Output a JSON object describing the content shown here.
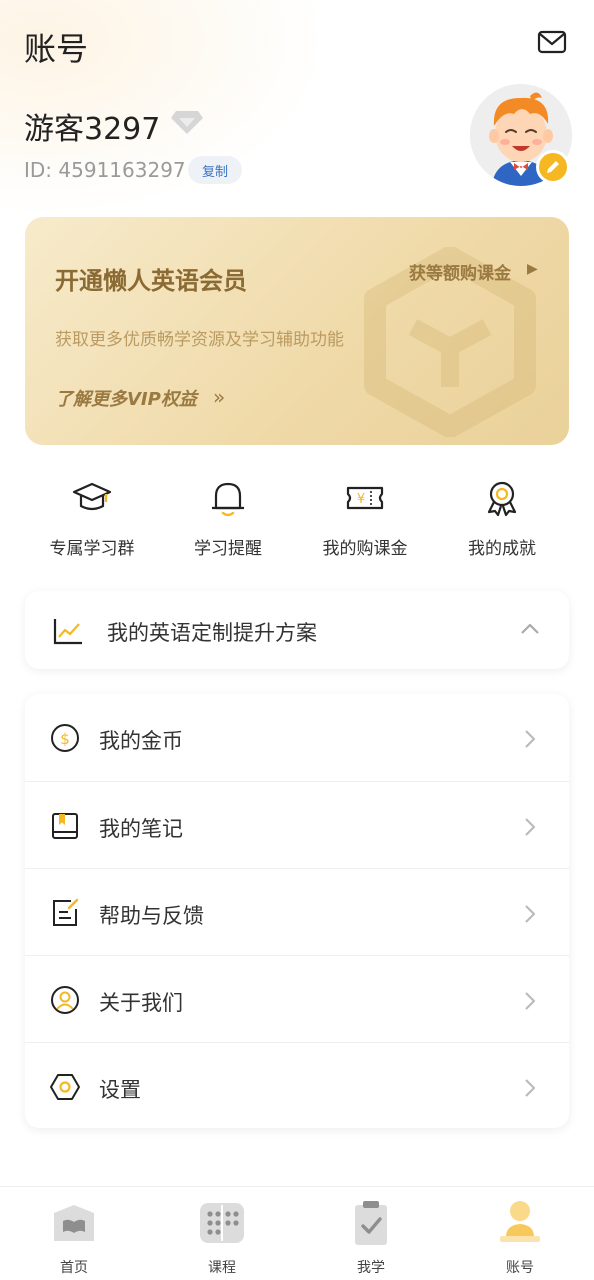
{
  "header": {
    "title": "账号"
  },
  "profile": {
    "username": "游客3297",
    "user_id": "ID: 4591163297",
    "copy_label": "复制"
  },
  "vip": {
    "title": "开通懒人英语会员",
    "description": "获取更多优质畅学资源及学习辅助功能",
    "more_label": "了解更多VIP权益",
    "voucher_label": "获等额购课金"
  },
  "quick_actions": [
    {
      "label": "专属学习群",
      "icon": "graduation-cap-icon"
    },
    {
      "label": "学习提醒",
      "icon": "bell-icon"
    },
    {
      "label": "我的购课金",
      "icon": "ticket-icon"
    },
    {
      "label": "我的成就",
      "icon": "medal-icon"
    }
  ],
  "plan": {
    "label": "我的英语定制提升方案"
  },
  "menu": [
    {
      "label": "我的金币",
      "icon": "coin-icon"
    },
    {
      "label": "我的笔记",
      "icon": "notebook-icon"
    },
    {
      "label": "帮助与反馈",
      "icon": "feedback-icon"
    },
    {
      "label": "关于我们",
      "icon": "user-circle-icon"
    },
    {
      "label": "设置",
      "icon": "settings-icon"
    }
  ],
  "tabs": [
    {
      "label": "首页",
      "icon": "book-icon",
      "active": false
    },
    {
      "label": "课程",
      "icon": "grid-icon",
      "active": false
    },
    {
      "label": "我学",
      "icon": "clipboard-icon",
      "active": false
    },
    {
      "label": "账号",
      "icon": "account-icon",
      "active": true
    }
  ],
  "colors": {
    "accent": "#f5b820",
    "vip_text": "#8b6a33",
    "tab_inactive": "#d9d9d9",
    "tab_active": "#f7c95a"
  }
}
